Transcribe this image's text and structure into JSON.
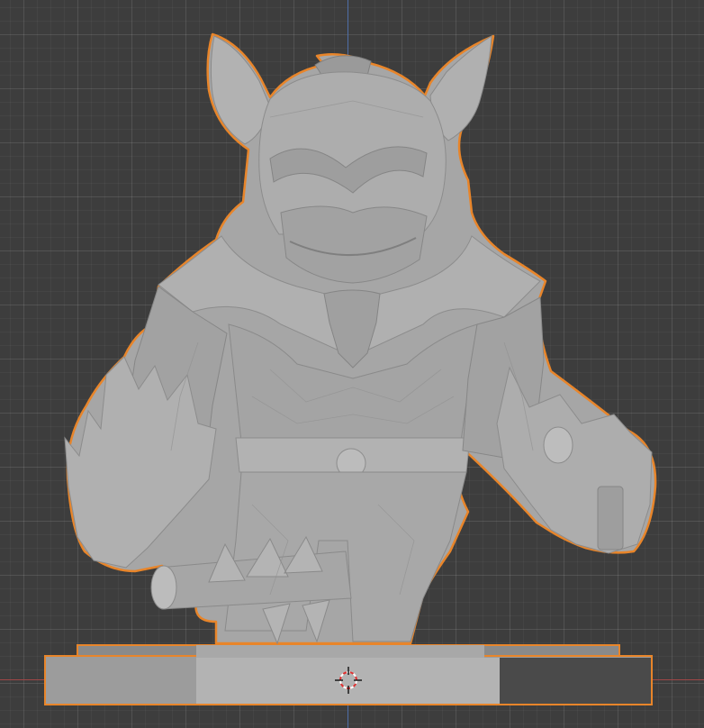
{
  "viewport": {
    "background_color": "#3d3d3d",
    "axis_y_color": "#4f6fa8",
    "axis_x_color": "#a04747"
  },
  "model": {
    "object": "character-figurine",
    "base": "rectangular-pedestal",
    "base_pad": "stepped-plinth",
    "selection_outline_color": "#e8852a",
    "mesh_color": "#a6a6a6",
    "mesh_shadow_color": "#8a8a8a",
    "mesh_highlight_color": "#bdbdbd",
    "base_front_color": "#9a9a9a",
    "base_top_color": "#b4b4b4",
    "base_side_color": "#4a4a4a"
  },
  "cursor": {
    "icon": "3d-cursor-icon",
    "ring_color_a": "#e03030",
    "ring_color_b": "#ffffff"
  }
}
